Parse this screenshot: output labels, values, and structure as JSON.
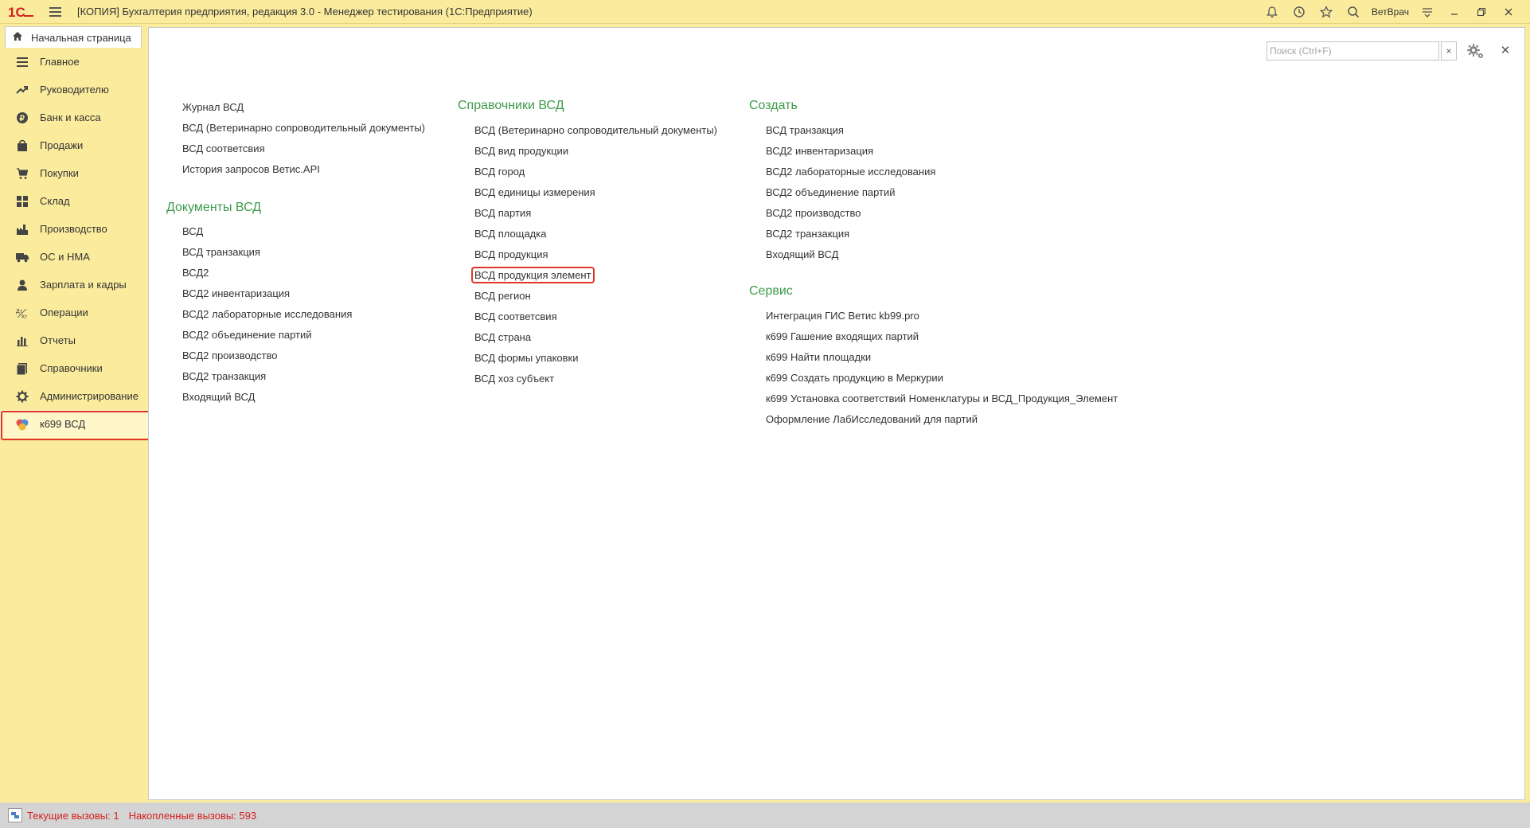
{
  "window": {
    "title": "[КОПИЯ] Бухгалтерия предприятия, редакция 3.0  - Менеджер тестирования (1С:Предприятие)",
    "user": "ВетВрач"
  },
  "tabs": {
    "home_label": "Начальная страница"
  },
  "sidebar": {
    "items": [
      {
        "label": "Главное",
        "icon": "menu-lines-icon"
      },
      {
        "label": "Руководителю",
        "icon": "trend-up-icon"
      },
      {
        "label": "Банк и касса",
        "icon": "ruble-coin-icon"
      },
      {
        "label": "Продажи",
        "icon": "shopping-bag-icon"
      },
      {
        "label": "Покупки",
        "icon": "cart-icon"
      },
      {
        "label": "Склад",
        "icon": "warehouse-grid-icon"
      },
      {
        "label": "Производство",
        "icon": "factory-icon"
      },
      {
        "label": "ОС и НМА",
        "icon": "truck-icon"
      },
      {
        "label": "Зарплата и кадры",
        "icon": "person-icon"
      },
      {
        "label": "Операции",
        "icon": "debit-credit-icon"
      },
      {
        "label": "Отчеты",
        "icon": "bar-chart-icon"
      },
      {
        "label": "Справочники",
        "icon": "books-icon"
      },
      {
        "label": "Администрирование",
        "icon": "gear-icon"
      },
      {
        "label": "к699 ВСД",
        "icon": "k699-logo-icon"
      }
    ]
  },
  "search": {
    "placeholder": "Поиск (Ctrl+F)",
    "value": ""
  },
  "content": {
    "col1": {
      "links_top": [
        "Журнал ВСД",
        "ВСД (Ветеринарно сопроводительный документы)",
        "ВСД соответсвия",
        "История запросов Ветис.API"
      ],
      "heading": "Документы ВСД",
      "links": [
        "ВСД",
        "ВСД транзакция",
        "ВСД2",
        "ВСД2 инвентаризация",
        "ВСД2 лабораторные исследования",
        "ВСД2 объединение партий",
        "ВСД2 производство",
        "ВСД2 транзакция",
        "Входящий ВСД"
      ]
    },
    "col2": {
      "heading": "Справочники ВСД",
      "links": [
        "ВСД (Ветеринарно сопроводительный документы)",
        "ВСД вид продукции",
        "ВСД город",
        "ВСД единицы измерения",
        "ВСД партия",
        "ВСД площадка",
        "ВСД продукция",
        "ВСД продукция элемент",
        "ВСД регион",
        "ВСД соответсвия",
        "ВСД страна",
        "ВСД формы упаковки",
        "ВСД хоз субъект"
      ]
    },
    "col3": {
      "heading_create": "Создать",
      "links_create": [
        "ВСД транзакция",
        "ВСД2 инвентаризация",
        "ВСД2 лабораторные исследования",
        "ВСД2 объединение партий",
        "ВСД2 производство",
        "ВСД2 транзакция",
        "Входящий ВСД"
      ],
      "heading_service": "Сервис",
      "links_service": [
        "Интеграция ГИС Ветис kb99.pro",
        "к699 Гашение входящих партий",
        "к699 Найти площадки",
        "к699 Создать продукцию в Меркурии",
        "к699 Установка соответствий Номенклатуры и ВСД_Продукция_Элемент",
        "Оформление ЛабИсследований для партий"
      ]
    }
  },
  "status": {
    "current_calls": "Текущие вызовы: 1",
    "accumulated_calls": "Накопленные вызовы: 593"
  },
  "colors": {
    "heading_green": "#3e9a4a",
    "highlight_red": "#e0352b",
    "sidebar_yellow": "#fbec9d",
    "status_red": "#d42020"
  }
}
